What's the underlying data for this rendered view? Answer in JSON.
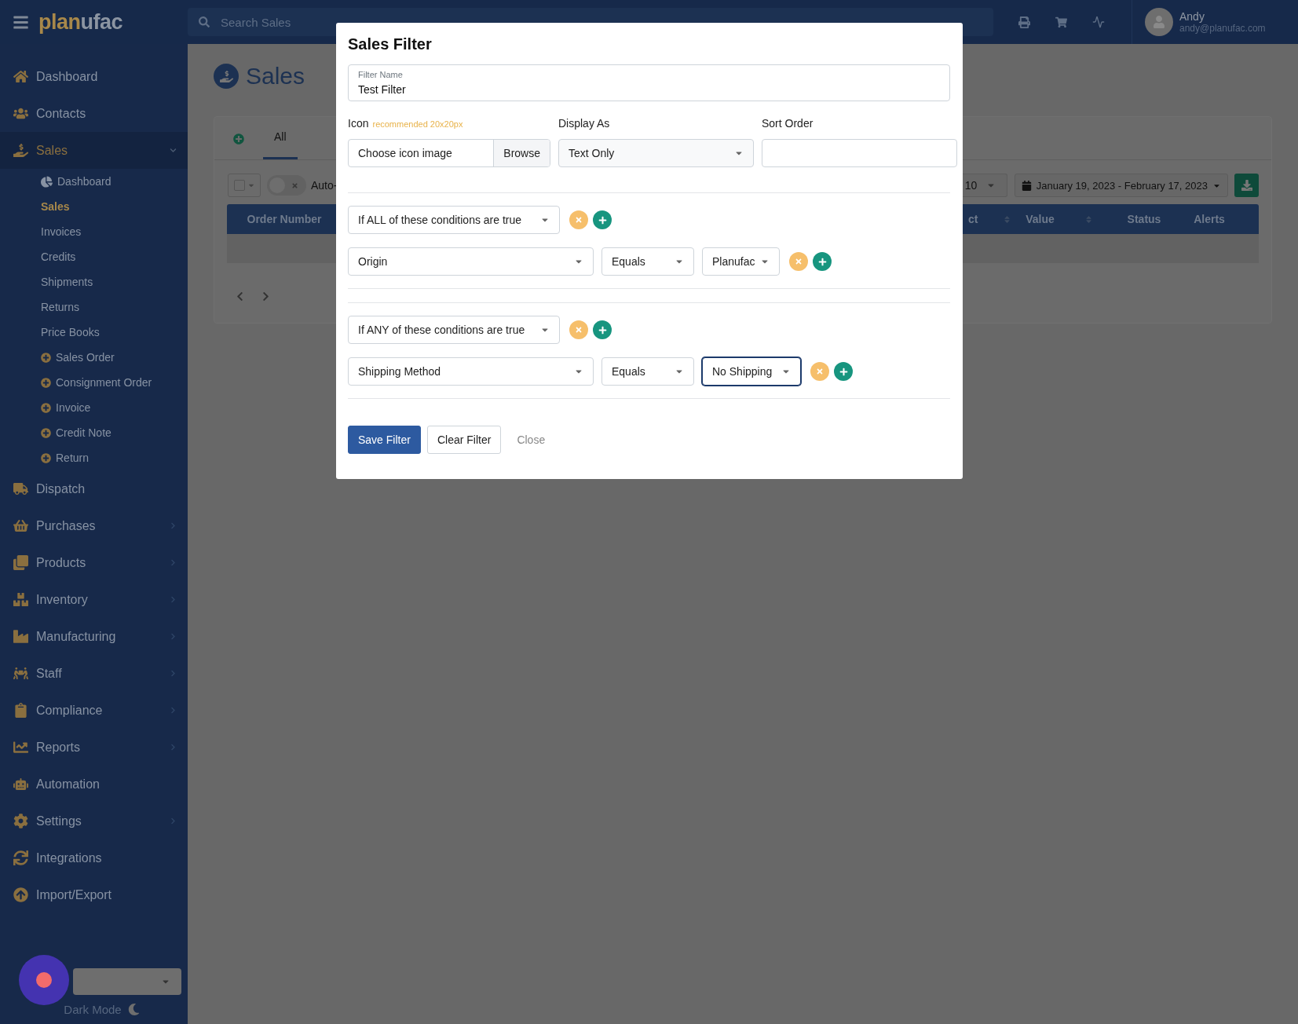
{
  "header": {
    "logo": [
      "plan",
      "ufac"
    ],
    "search": {
      "placeholder": "Search Sales"
    },
    "user": {
      "name": "Andy",
      "email": "andy@planufac.com"
    }
  },
  "sidebar": {
    "items": [
      {
        "label": "Dashboard",
        "selected": false
      },
      {
        "label": "Contacts",
        "selected": false
      },
      {
        "label": "Sales",
        "selected": true,
        "expanded": true,
        "children": [
          {
            "label": "Dashboard",
            "kind": "chart",
            "selected": false
          },
          {
            "label": "Sales",
            "kind": "link",
            "selected": true
          },
          {
            "label": "Invoices",
            "kind": "link",
            "selected": false
          },
          {
            "label": "Credits",
            "kind": "link",
            "selected": false
          },
          {
            "label": "Shipments",
            "kind": "link",
            "selected": false
          },
          {
            "label": "Returns",
            "kind": "link",
            "selected": false
          },
          {
            "label": "Price Books",
            "kind": "link",
            "selected": false
          },
          {
            "label": "Sales Order",
            "kind": "create",
            "selected": false
          },
          {
            "label": "Consignment Order",
            "kind": "create",
            "selected": false
          },
          {
            "label": "Invoice",
            "kind": "create",
            "selected": false
          },
          {
            "label": "Credit Note",
            "kind": "create",
            "selected": false
          },
          {
            "label": "Return",
            "kind": "create",
            "selected": false
          }
        ]
      },
      {
        "label": "Dispatch",
        "selected": false
      },
      {
        "label": "Purchases",
        "selected": false,
        "expanded": false
      },
      {
        "label": "Products",
        "selected": false,
        "expanded": false
      },
      {
        "label": "Inventory",
        "selected": false,
        "expanded": false
      },
      {
        "label": "Manufacturing",
        "selected": false,
        "expanded": false
      },
      {
        "label": "Staff",
        "selected": false,
        "expanded": false
      },
      {
        "label": "Compliance",
        "selected": false,
        "expanded": false
      },
      {
        "label": "Reports",
        "selected": false,
        "expanded": false
      },
      {
        "label": "Automation",
        "selected": false
      },
      {
        "label": "Settings",
        "selected": false,
        "expanded": false
      },
      {
        "label": "Integrations",
        "selected": false
      },
      {
        "label": "Import/Export",
        "selected": false
      }
    ],
    "footer": {
      "dark_mode": "Dark Mode"
    }
  },
  "page": {
    "title": "Sales",
    "tabs": [
      {
        "label": "All",
        "selected": true
      }
    ],
    "toolbar": {
      "checkbox": {
        "checked": false
      },
      "toggle": {
        "on": false,
        "label": "Auto-"
      },
      "page_size": "10",
      "date_range": "January 19, 2023 - February 17, 2023"
    },
    "table": {
      "columns": [
        {
          "label": "Order Number",
          "sortable": false
        },
        {
          "label": "ct",
          "sortable": true
        },
        {
          "label": "Value",
          "sortable": true
        },
        {
          "label": "Status",
          "sortable": false
        },
        {
          "label": "Alerts",
          "sortable": false
        }
      ]
    }
  },
  "modal": {
    "title": "Sales Filter",
    "filter_name": {
      "label": "Filter Name",
      "value": "Test Filter"
    },
    "icon": {
      "label": "Icon",
      "hint": "recommended 20x20px",
      "text": "Choose icon image",
      "button": "Browse"
    },
    "display_as": {
      "label": "Display As",
      "value": "Text Only"
    },
    "sort_order": {
      "label": "Sort Order"
    },
    "groups": [
      {
        "mode": "If ALL of these conditions are true",
        "conditions": [
          {
            "field": "Origin",
            "operator": "Equals",
            "value": "Planufac",
            "focused": false
          }
        ]
      },
      {
        "mode": "If ANY of these conditions are true",
        "conditions": [
          {
            "field": "Shipping Method",
            "operator": "Equals",
            "value": "No Shipping",
            "focused": true
          }
        ]
      }
    ],
    "buttons": {
      "save": "Save Filter",
      "clear": "Clear Filter",
      "close": "Close"
    }
  }
}
